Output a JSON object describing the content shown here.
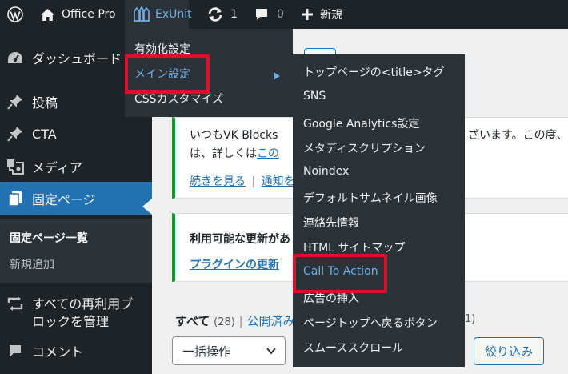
{
  "adminbar": {
    "site_name": "Office Pro",
    "exunit_label": "ExUnit",
    "updates_count": "1",
    "comments_count": "0",
    "new_label": "新規"
  },
  "exunit_menu": {
    "items": [
      "有効化設定",
      "メイン設定",
      "CSSカスタマイズ"
    ]
  },
  "main_submenu": {
    "items": [
      "トップページの<title>タグ",
      "SNS",
      "Google Analytics設定",
      "メタディスクリプション",
      "Noindex",
      "デフォルトサムネイル画像",
      "連絡先情報",
      "HTML サイトマップ",
      "Call To Action",
      "広告の挿入",
      "ページトップへ戻るボタン",
      "スムーススクロール"
    ]
  },
  "sidebar": {
    "items": [
      {
        "label": "ダッシュボード",
        "icon": "dashboard-icon"
      },
      {
        "label": "投稿",
        "icon": "pin-icon"
      },
      {
        "label": "CTA",
        "icon": "pin-icon"
      },
      {
        "label": "メディア",
        "icon": "media-icon"
      },
      {
        "label": "固定ページ",
        "icon": "pages-icon"
      },
      {
        "label": "すべての再利用ブ",
        "label2": "ロックを管理",
        "icon": "reusable-blocks-icon"
      },
      {
        "label": "コメント",
        "icon": "comments-icon"
      }
    ],
    "submenu": [
      "固定ページ一覧",
      "新規追加"
    ]
  },
  "notice1": {
    "line1": "いつもVK Blocks",
    "line1_tail": "ざいます。この度、",
    "line2_prefix": "は、詳しくは",
    "line2_link": "この",
    "link_more": "続きを見る",
    "sep": "|",
    "link_notify": "通知を"
  },
  "notice2": {
    "title": "利用可能な更新があ",
    "link": "プラグインの更新"
  },
  "filters": {
    "all_label": "すべて",
    "all_count": "(28)",
    "sep": "|",
    "published_label": "公開済み",
    "trailing": "1)",
    "bulk_select": "一括操作",
    "filter_button": "絞り込み"
  },
  "colors": {
    "adminbar_bg": "#1d2327",
    "flyout_bg": "#2c3338",
    "accent": "#2271b1",
    "highlight_text": "#72aee6",
    "red_frame": "#e00d2b",
    "notice_border": "#00a32a"
  }
}
